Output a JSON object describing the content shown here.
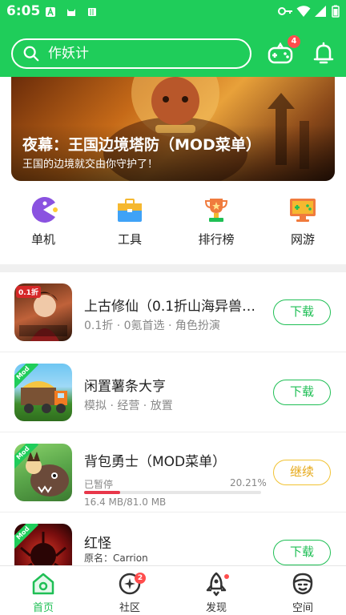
{
  "status_bar": {
    "time": "6:05"
  },
  "search": {
    "placeholder": "作妖计"
  },
  "header": {
    "gamepad_badge": "4"
  },
  "banner": {
    "title": "夜幕：王国边境塔防（MOD菜单）",
    "subtitle": "王国的边境就交由你守护了！"
  },
  "categories": [
    {
      "label": "单机",
      "icon": "pacman-icon"
    },
    {
      "label": "工具",
      "icon": "toolbox-icon"
    },
    {
      "label": "排行榜",
      "icon": "trophy-icon"
    },
    {
      "label": "网游",
      "icon": "monitor-gamepad-icon"
    }
  ],
  "games": [
    {
      "name": "上古修仙（0.1折山海异兽…",
      "tags": "0.1折 · 0氪首选 · 角色扮演",
      "button": "下载",
      "badge": "0.1折"
    },
    {
      "name": "闲置薯条大亨",
      "tags": "模拟 · 经营 · 放置",
      "button": "下载",
      "badge": "Mod"
    },
    {
      "name": "背包勇士（MOD菜单）",
      "status": "已暂停",
      "percent": "20.21%",
      "progress": 0.2021,
      "size": "16.4 MB/81.0 MB",
      "button": "继续",
      "badge": "Mod"
    },
    {
      "name": "红怪",
      "original": "原名：Carrion",
      "button": "下载",
      "badge": "Mod"
    }
  ],
  "nav": [
    {
      "label": "首页",
      "icon": "home-icon",
      "active": true
    },
    {
      "label": "社区",
      "icon": "community-icon",
      "badge": "2"
    },
    {
      "label": "发现",
      "icon": "rocket-icon"
    },
    {
      "label": "空间",
      "icon": "profile-icon"
    }
  ],
  "colors": {
    "brand": "#1fcd5a",
    "download": "#1fbf55",
    "continue": "#e6a817",
    "badge": "#ff4d4d",
    "progress": "#e8374a"
  }
}
